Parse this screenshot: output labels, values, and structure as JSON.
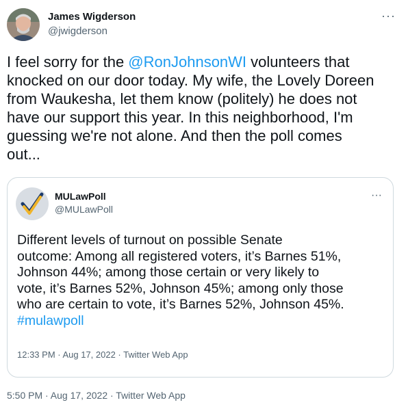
{
  "tweet": {
    "author_name": "James Wigderson",
    "author_handle": "@jwigderson",
    "more_icon": "···",
    "text_pre": "I feel sorry for the ",
    "mention": "@RonJohnsonWI",
    "text_post": " volunteers that\nknocked on our door today. My wife, the Lovely Doreen\nfrom Waukesha, let them know (politely) he does not\nhave our support this year. In this neighborhood, I'm\nguessing we're not alone. And then the poll comes\nout...",
    "timestamp": "5:50 PM · Aug 17, 2022 · Twitter Web App"
  },
  "quoted_tweet": {
    "author_name": "MULawPoll",
    "author_handle": "@MULawPoll",
    "more_icon": "···",
    "text": "Different levels of turnout on possible Senate\noutcome: Among all registered voters, it’s Barnes 51%,\nJohnson 44%; among those certain or very likely to\nvote, it’s Barnes 52%, Johnson 45%; among only those\nwho are certain to vote, it’s Barnes 52%, Johnson 45%.",
    "hashtag": "#mulawpoll",
    "timestamp": "12:33 PM · Aug 17, 2022 · Twitter Web App"
  },
  "colors": {
    "link": "#1d9bf0",
    "secondary_text": "#536471",
    "border": "#cfd9de"
  }
}
